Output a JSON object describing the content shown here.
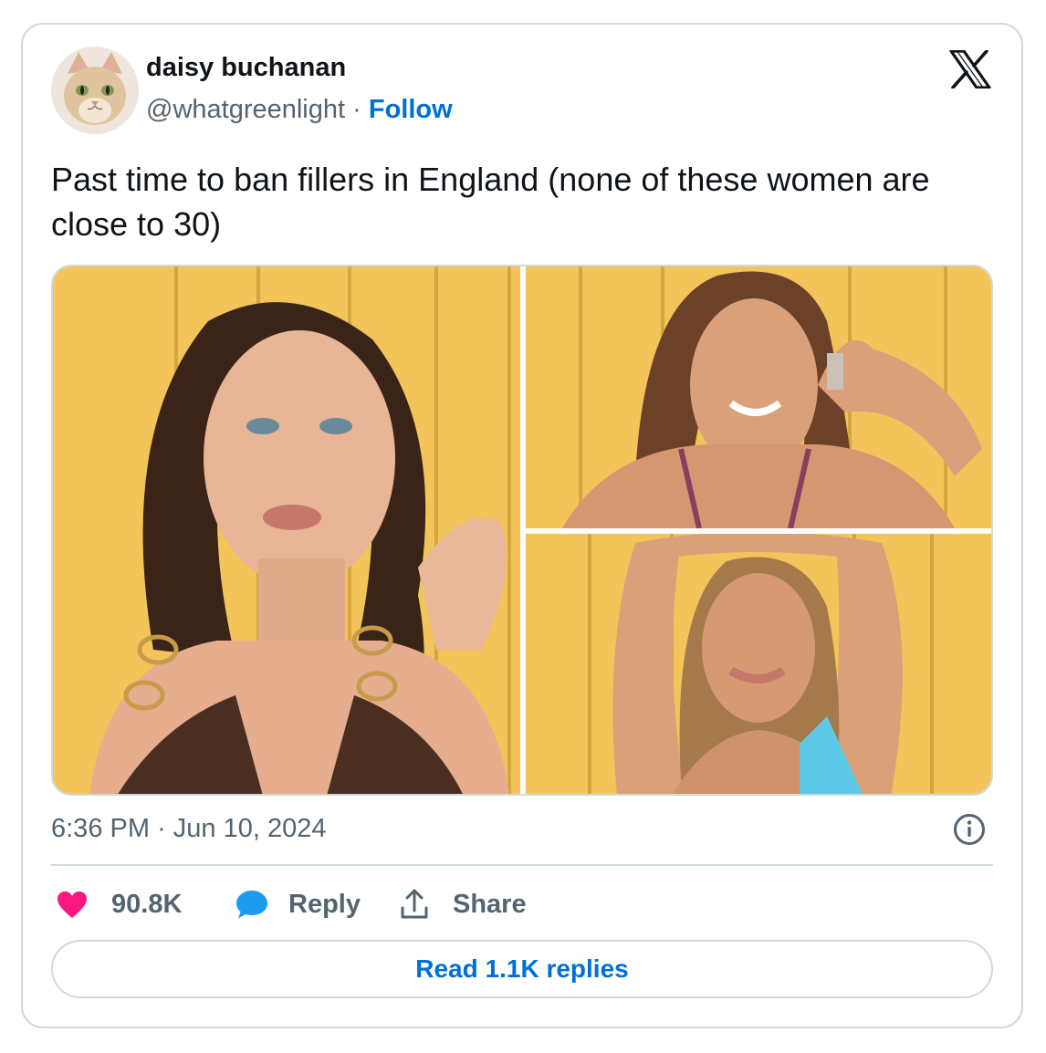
{
  "author": {
    "display_name": "daisy buchanan",
    "handle": "@whatgreenlight",
    "separator": "·",
    "follow_label": "Follow"
  },
  "brand": {
    "logo_icon": "x-logo-icon",
    "name": "X"
  },
  "tweet": {
    "text": "Past time to ban fillers in England (none of these women are close to 30)",
    "photos": [
      {
        "icon": "photo-woman-brown-bikini"
      },
      {
        "icon": "photo-woman-purple-bikini"
      },
      {
        "icon": "photo-woman-blue-bikini"
      }
    ],
    "time": "6:36 PM",
    "date_separator": "·",
    "date": "Jun 10, 2024"
  },
  "actions": {
    "like_count": "90.8K",
    "reply_label": "Reply",
    "share_label": "Share",
    "read_replies_label": "Read 1.1K replies"
  },
  "colors": {
    "heart": "#f91880",
    "reply_bubble": "#1d9bf0",
    "link": "#006fd6",
    "muted": "#536471",
    "border": "#cfd9de",
    "photo_background": "#f2c45a"
  }
}
